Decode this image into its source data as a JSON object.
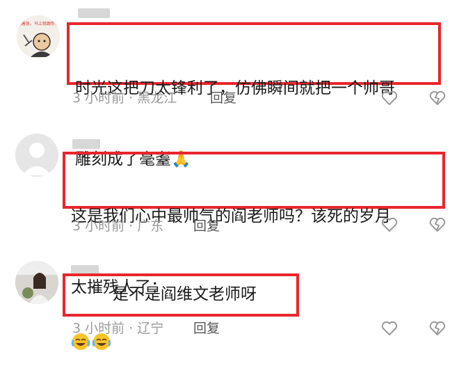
{
  "comments": [
    {
      "text_line1": "时光这把刀太锋利了，仿佛瞬间就把一个帅哥",
      "text_line2": "雕刻成了毫耋🙏",
      "time": "3 小时前 · 黑龙江",
      "reply_label": "回复",
      "avatar_caption": "别着急，马上就跟你说"
    },
    {
      "text_line1": "这是我们心中最帅气的阎老师吗？该死的岁月",
      "text_line2": "太摧残人了：",
      "time": "3 小时前 · 广东",
      "reply_label": "回复"
    },
    {
      "text": "是不是阎维文老师呀",
      "emojis": [
        "laughing-crying-emoji",
        "laughing-crying-emoji"
      ],
      "time": "3 小时前 · 辽宁",
      "reply_label": "回复"
    }
  ],
  "icons": {
    "like": "heart-outline-icon",
    "dislike": "broken-heart-icon"
  },
  "colors": {
    "highlight": "#e8262c",
    "meta": "#9a9a9a",
    "username_blur": "#d7d7d7"
  }
}
